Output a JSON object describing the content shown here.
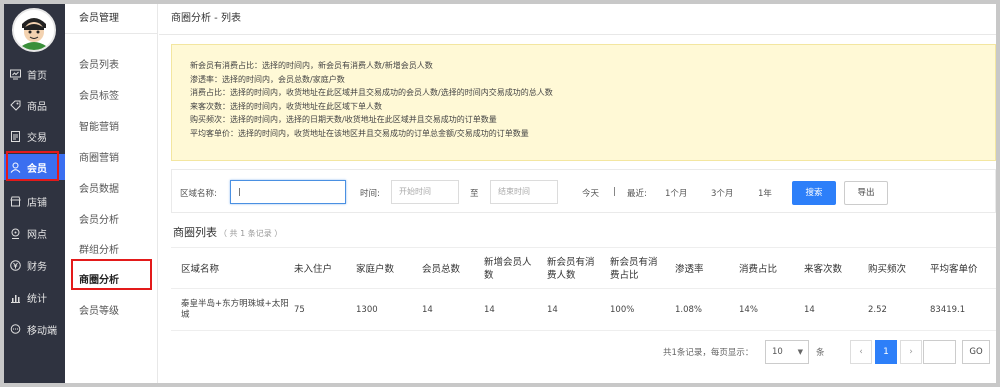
{
  "nav": {
    "items": [
      {
        "label": "首页",
        "icon": "monitor-icon"
      },
      {
        "label": "商品",
        "icon": "tag-icon"
      },
      {
        "label": "交易",
        "icon": "document-icon"
      },
      {
        "label": "会员",
        "icon": "user-icon"
      },
      {
        "label": "店铺",
        "icon": "store-icon"
      },
      {
        "label": "网点",
        "icon": "location-icon"
      },
      {
        "label": "财务",
        "icon": "yen-icon"
      },
      {
        "label": "统计",
        "icon": "bar-chart-icon"
      },
      {
        "label": "移动端",
        "icon": "chat-icon"
      }
    ],
    "active_index": 3,
    "accent": "#3b6ff0",
    "highlight": "#e31a1a"
  },
  "subnav": {
    "title": "会员管理",
    "items": [
      "会员列表",
      "会员标签",
      "智能营销",
      "商圈营销",
      "会员数据",
      "会员分析",
      "群组分析",
      "商圈分析",
      "会员等级"
    ],
    "active_index": 7
  },
  "page": {
    "title": "商圈分析 - 列表"
  },
  "notice": {
    "lines": [
      "新会员有消费占比：选择的时间内，新会员有消费人数/新增会员人数",
      "渗透率：选择的时间内，会员总数/家庭户数",
      "消费占比：选择的时间内，收货地址在此区域并且交易成功的会员人数/选择的时间内交易成功的总人数",
      "来客次数：选择的时间内，收货地址在此区域下单人数",
      "购买频次：选择的时间内，选择的日期天数/收货地址在此区域并且交易成功的订单数量",
      "平均客单价：选择的时间内，收货地址在该地区并且交易成功的订单总金额/交易成功的订单数量"
    ]
  },
  "filter": {
    "area_label": "区域名称:",
    "area_value": "",
    "time_label": "时间:",
    "start_placeholder": "开始时间",
    "to_label": "至",
    "end_placeholder": "结束时间",
    "today": "今天",
    "separator": "|",
    "recent_label": "最近:",
    "one_month": "1个月",
    "three_month": "3个月",
    "one_year": "1年",
    "search_button": "搜索",
    "export_button": "导出"
  },
  "list": {
    "title": "商圈列表",
    "count_text": "（ 共 1 条记录 ）",
    "columns": [
      "区域名称",
      "未入住户",
      "家庭户数",
      "会员总数",
      "新增会员人数",
      "新会员有消费人数",
      "新会员有消费占比",
      "渗透率",
      "消费占比",
      "来客次数",
      "购买频次",
      "平均客单价"
    ],
    "rows": [
      [
        "秦皇半岛+东方明珠城+太阳城",
        "75",
        "1300",
        "14",
        "14",
        "14",
        "100%",
        "1.08%",
        "14%",
        "14",
        "2.52",
        "83419.1"
      ]
    ]
  },
  "pager": {
    "summary": "共1条记录，每页显示：",
    "page_size": "10",
    "unit": "条",
    "prev": "‹",
    "current": "1",
    "next": "›",
    "go": "GO"
  }
}
